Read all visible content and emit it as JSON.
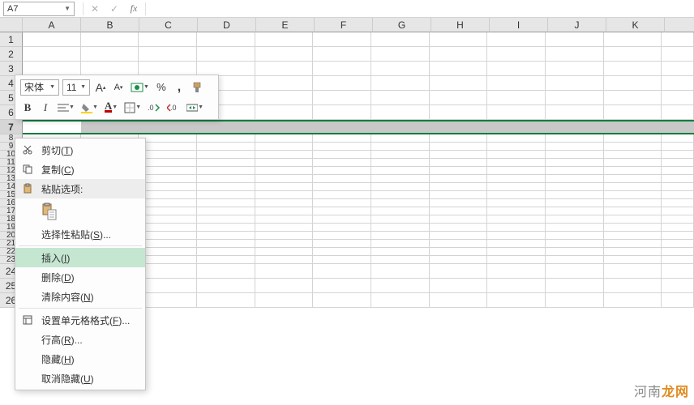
{
  "formula_bar": {
    "name_box": "A7",
    "cancel_glyph": "✕",
    "confirm_glyph": "✓",
    "fx_label": "fx"
  },
  "columns": [
    "A",
    "B",
    "C",
    "D",
    "E",
    "F",
    "G",
    "H",
    "I",
    "J",
    "K"
  ],
  "rows": [
    "1",
    "2",
    "3",
    "4",
    "5",
    "6",
    "7",
    "8",
    "9",
    "10",
    "11",
    "12",
    "13",
    "14",
    "15",
    "16",
    "17",
    "18",
    "19",
    "20",
    "21",
    "22",
    "23",
    "24",
    "25",
    "26"
  ],
  "selected_row_index": 6,
  "mini_toolbar": {
    "font_name": "宋体",
    "font_size": "11",
    "grow_font": "A",
    "shrink_font": "A",
    "percent": "%",
    "comma": ",",
    "bold": "B",
    "italic": "I"
  },
  "context_menu": {
    "cut": "剪切(T)",
    "copy": "复制(C)",
    "paste_header": "粘贴选项:",
    "paste_special": "选择性粘贴(S)...",
    "insert": "插入(I)",
    "delete": "删除(D)",
    "clear": "清除内容(N)",
    "format": "设置单元格格式(F)...",
    "row_height": "行高(R)...",
    "hide": "隐藏(H)",
    "unhide": "取消隐藏(U)"
  },
  "watermark_prefix": "河南",
  "watermark_suffix": "龙网"
}
